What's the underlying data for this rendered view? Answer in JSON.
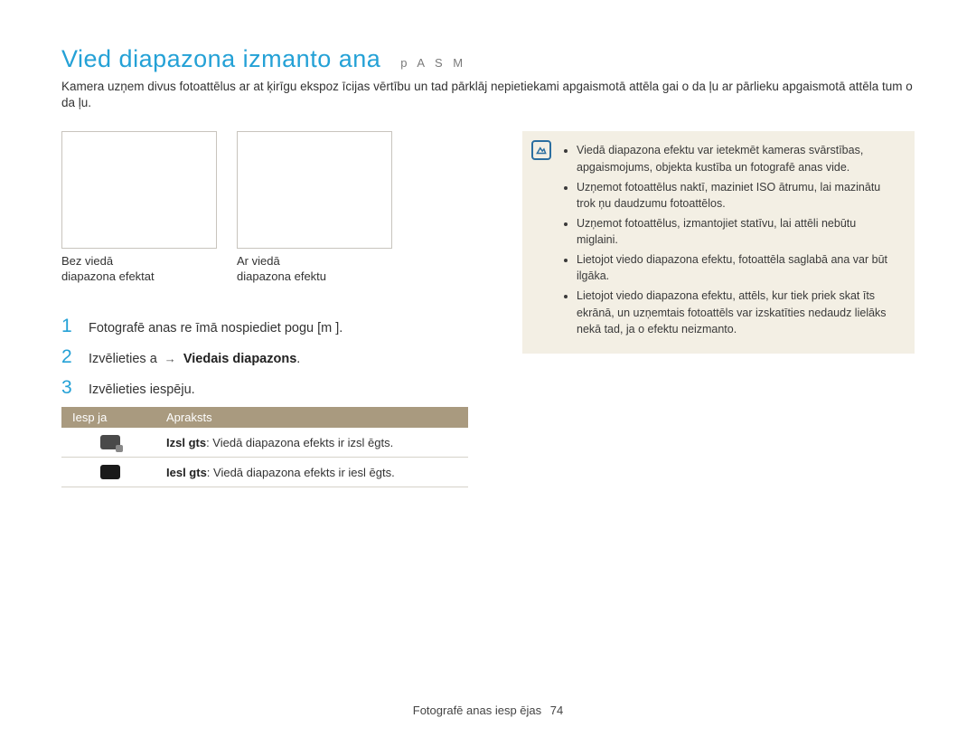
{
  "header": {
    "title": "Vied   diapazona izmanto ana",
    "modes": "p A S M",
    "subtitle": "Kamera uzņem divus fotoattēlus ar at ķirīgu ekspoz īcijas vērtību un tad pārklāj nepietiekami apgaismotā attēla gai o da ļu ar pārlieku apgaismotā attēla tum o da ļu."
  },
  "images": {
    "left_caption": "Bez viedā\ndiapazona efektat",
    "right_caption": "Ar viedā\ndiapazona efektu"
  },
  "steps": {
    "s1": "Fotografē anas re   īmā nospiediet pogu [m        ].",
    "s2_a": "Izvēlieties a",
    "s2_b": "Viedais diapazons",
    "s2_c": ".",
    "s3": "Izvēlieties iespēju."
  },
  "opt_table": {
    "head_option": "Iesp  ja",
    "head_desc": "Apraksts",
    "rows": [
      {
        "label_bold": "Izsl  gts",
        "label_rest": ": Viedā diapazona efekts ir izsl ēgts.",
        "icon": "off"
      },
      {
        "label_bold": "Iesl  gts",
        "label_rest": ": Viedā diapazona efekts ir iesl ēgts.",
        "icon": "on"
      }
    ]
  },
  "notes": [
    "Viedā diapazona efektu var ietekmēt kameras svārstības, apgaismojums, objekta kustība un fotografē anas vide.",
    "Uzņemot fotoattēlus naktī, maziniet ISO ātrumu, lai mazinātu trok ņu daudzumu fotoattēlos.",
    "Uzņemot fotoattēlus, izmantojiet statīvu, lai attēli nebūtu miglaini.",
    "Lietojot viedo diapazona efektu, fotoattēla saglabā ana var būt ilgāka.",
    "Lietojot viedo diapazona efektu, attēls, kur  tiek priek skat  īts ekrānā, un uzņemtais fotoattēls var izskatīties nedaudz lielāks nekā tad, ja  o efektu neizmanto."
  ],
  "footer": {
    "section": "Fotografē anas iesp ējas",
    "page": "74"
  }
}
